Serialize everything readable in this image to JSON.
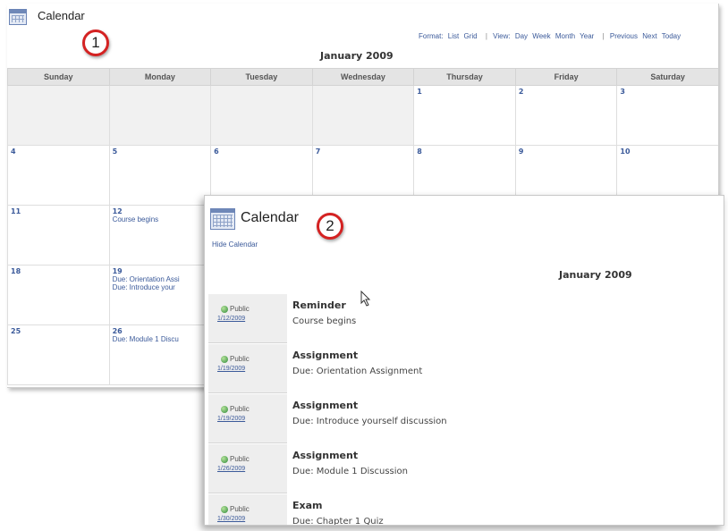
{
  "back_window": {
    "title": "Calendar",
    "badge": "1",
    "nav": [
      {
        "label": "Format:"
      },
      {
        "label": "List"
      },
      {
        "label": "Grid"
      },
      {
        "label": "View:"
      },
      {
        "label": "Day"
      },
      {
        "label": "Week"
      },
      {
        "label": "Month"
      },
      {
        "label": "Year"
      },
      {
        "label": "Previous"
      },
      {
        "label": "Next"
      },
      {
        "label": "Today"
      }
    ],
    "month_title": "January 2009",
    "weekdays": [
      "Sunday",
      "Monday",
      "Tuesday",
      "Wednesday",
      "Thursday",
      "Friday",
      "Saturday"
    ],
    "weeks": [
      [
        {
          "d": "",
          "e": []
        },
        {
          "d": "",
          "e": []
        },
        {
          "d": "",
          "e": []
        },
        {
          "d": "",
          "e": []
        },
        {
          "d": "1",
          "e": []
        },
        {
          "d": "2",
          "e": []
        },
        {
          "d": "3",
          "e": []
        }
      ],
      [
        {
          "d": "4",
          "e": []
        },
        {
          "d": "5",
          "e": []
        },
        {
          "d": "6",
          "e": []
        },
        {
          "d": "7",
          "e": []
        },
        {
          "d": "8",
          "e": []
        },
        {
          "d": "9",
          "e": []
        },
        {
          "d": "10",
          "e": []
        }
      ],
      [
        {
          "d": "11",
          "e": []
        },
        {
          "d": "12",
          "e": [
            "Course begins"
          ]
        },
        {
          "d": "",
          "e": []
        },
        {
          "d": "",
          "e": []
        },
        {
          "d": "",
          "e": []
        },
        {
          "d": "",
          "e": []
        },
        {
          "d": "",
          "e": []
        }
      ],
      [
        {
          "d": "18",
          "e": []
        },
        {
          "d": "19",
          "e": [
            "Due: Orientation Assi",
            "Due: Introduce your"
          ]
        },
        {
          "d": "",
          "e": []
        },
        {
          "d": "",
          "e": []
        },
        {
          "d": "",
          "e": []
        },
        {
          "d": "",
          "e": []
        },
        {
          "d": "",
          "e": []
        }
      ],
      [
        {
          "d": "25",
          "e": []
        },
        {
          "d": "26",
          "e": [
            "Due: Module 1 Discu"
          ]
        },
        {
          "d": "",
          "e": []
        },
        {
          "d": "",
          "e": []
        },
        {
          "d": "",
          "e": []
        },
        {
          "d": "",
          "e": []
        },
        {
          "d": "",
          "e": []
        }
      ]
    ]
  },
  "front_window": {
    "title": "Calendar",
    "badge": "2",
    "hide_link": "Hide Calendar",
    "month_title": "January 2009",
    "items": [
      {
        "visibility": "Public",
        "date": "1/12/2009",
        "type": "Reminder",
        "desc": "Course begins"
      },
      {
        "visibility": "Public",
        "date": "1/19/2009",
        "type": "Assignment",
        "desc": "Due: Orientation Assignment"
      },
      {
        "visibility": "Public",
        "date": "1/19/2009",
        "type": "Assignment",
        "desc": "Due: Introduce yourself discussion"
      },
      {
        "visibility": "Public",
        "date": "1/26/2009",
        "type": "Assignment",
        "desc": "Due: Module 1 Discussion"
      },
      {
        "visibility": "Public",
        "date": "1/30/2009",
        "type": "Exam",
        "desc": "Due: Chapter 1 Quiz"
      }
    ]
  },
  "colors": {
    "link": "#3b5a9a",
    "badge_ring": "#d42222",
    "header_bg": "#e4e4e4"
  },
  "icons": [
    "calendar-icon",
    "globe-icon",
    "mouse-cursor-icon"
  ]
}
